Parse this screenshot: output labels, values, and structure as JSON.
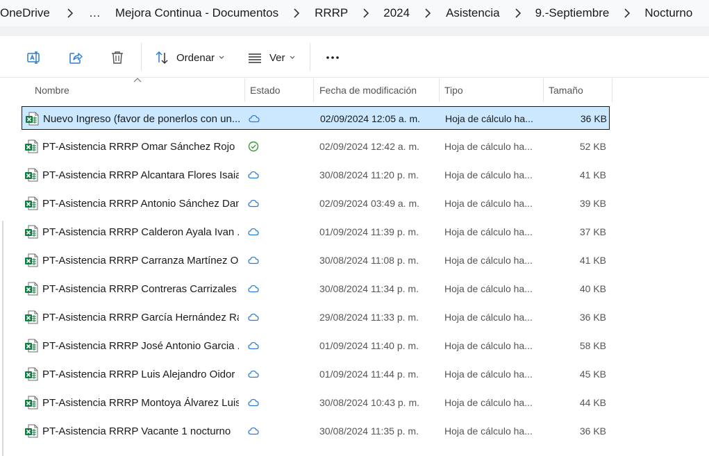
{
  "breadcrumb": {
    "items": [
      "OneDrive",
      "Mejora Continua - Documentos",
      "RRRP",
      "2024",
      "Asistencia",
      "9.-Septiembre",
      "Nocturno"
    ],
    "overflow": "…"
  },
  "toolbar": {
    "rename_icon": "rename-icon",
    "share_icon": "share-icon",
    "delete_icon": "trash-icon",
    "sort_label": "Ordenar",
    "view_label": "Ver",
    "more_label": "•••"
  },
  "columns": {
    "name": "Nombre",
    "state": "Estado",
    "date": "Fecha de modificación",
    "type": "Tipo",
    "size": "Tamaño"
  },
  "files": [
    {
      "name": "Nuevo Ingreso (favor de ponerlos con un...",
      "status": "cloud",
      "date": "02/09/2024 12:05 a. m.",
      "type": "Hoja de cálculo ha...",
      "size": "36 KB",
      "selected": true
    },
    {
      "name": "PT-Asistencia RRRP  Omar Sánchez Rojo",
      "status": "synced",
      "date": "02/09/2024 12:42 a. m.",
      "type": "Hoja de cálculo ha...",
      "size": "52 KB"
    },
    {
      "name": "PT-Asistencia RRRP Alcantara Flores Isaia...",
      "status": "cloud",
      "date": "30/08/2024 11:20 p. m.",
      "type": "Hoja de cálculo ha...",
      "size": "41 KB"
    },
    {
      "name": "PT-Asistencia RRRP Antonio Sánchez Dan...",
      "status": "cloud",
      "date": "02/09/2024 03:49 a. m.",
      "type": "Hoja de cálculo ha...",
      "size": "39 KB"
    },
    {
      "name": "PT-Asistencia RRRP Calderon Ayala Ivan ...",
      "status": "cloud",
      "date": "01/09/2024 11:39 p. m.",
      "type": "Hoja de cálculo ha...",
      "size": "37 KB"
    },
    {
      "name": "PT-Asistencia RRRP Carranza Martínez Os...",
      "status": "cloud",
      "date": "30/08/2024 11:08 p. m.",
      "type": "Hoja de cálculo ha...",
      "size": "41 KB"
    },
    {
      "name": "PT-Asistencia RRRP Contreras Carrizales J...",
      "status": "cloud",
      "date": "30/08/2024 11:34 p. m.",
      "type": "Hoja de cálculo ha...",
      "size": "40 KB"
    },
    {
      "name": "PT-Asistencia RRRP García Hernández Raúl",
      "status": "cloud",
      "date": "29/08/2024 11:33 p. m.",
      "type": "Hoja de cálculo ha...",
      "size": "36 KB"
    },
    {
      "name": "PT-Asistencia RRRP José Antonio Garcia ...",
      "status": "cloud",
      "date": "01/09/2024 11:40 p. m.",
      "type": "Hoja de cálculo ha...",
      "size": "58 KB"
    },
    {
      "name": "PT-Asistencia RRRP Luis Alejandro Oidor ...",
      "status": "cloud",
      "date": "01/09/2024 11:44 p. m.",
      "type": "Hoja de cálculo ha...",
      "size": "45 KB"
    },
    {
      "name": "PT-Asistencia RRRP Montoya Álvarez Luis...",
      "status": "cloud",
      "date": "30/08/2024 10:43 p. m.",
      "type": "Hoja de cálculo ha...",
      "size": "44 KB"
    },
    {
      "name": "PT-Asistencia RRRP Vacante 1 nocturno",
      "status": "cloud",
      "date": "30/08/2024 11:35 p. m.",
      "type": "Hoja de cálculo ha...",
      "size": "36 KB"
    }
  ],
  "colors": {
    "selection": "#cce8ff",
    "excel_green": "#107c41",
    "cloud_blue": "#2b7cd3",
    "synced_green": "#3a9a3a"
  }
}
